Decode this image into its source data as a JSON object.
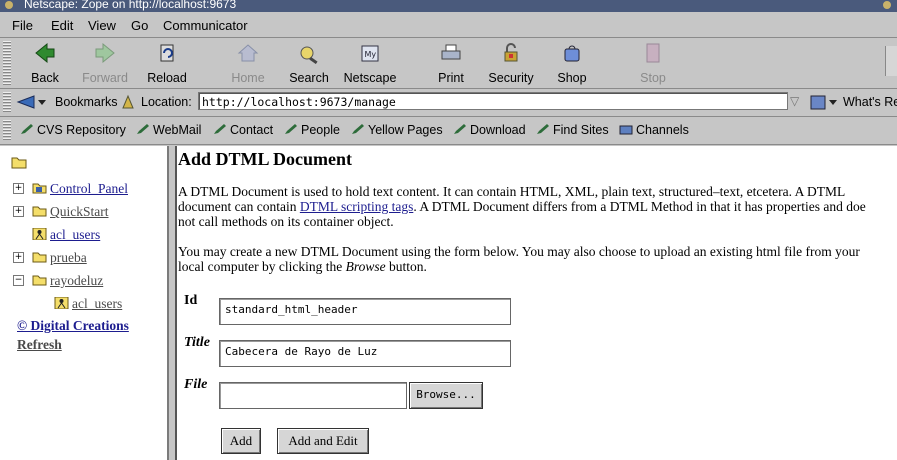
{
  "window": {
    "title": "Netscape: Zope on http://localhost:9673"
  },
  "menu": [
    "File",
    "Edit",
    "View",
    "Go",
    "Communicator"
  ],
  "toolbar": [
    {
      "label": "Back",
      "icon": "back-arrow-icon",
      "enabled": true
    },
    {
      "label": "Forward",
      "icon": "forward-arrow-icon",
      "enabled": false
    },
    {
      "label": "Reload",
      "icon": "reload-icon",
      "enabled": true
    },
    {
      "label": "Home",
      "icon": "home-icon",
      "enabled": false
    },
    {
      "label": "Search",
      "icon": "search-icon",
      "enabled": true
    },
    {
      "label": "Netscape",
      "icon": "netscape-icon",
      "enabled": true
    },
    {
      "label": "Print",
      "icon": "print-icon",
      "enabled": true
    },
    {
      "label": "Security",
      "icon": "lock-icon",
      "enabled": true
    },
    {
      "label": "Shop",
      "icon": "shop-icon",
      "enabled": true
    },
    {
      "label": "Stop",
      "icon": "stop-icon",
      "enabled": false
    }
  ],
  "location": {
    "bookmarks_label": "Bookmarks",
    "location_label": "Location:",
    "url": "http://localhost:9673/manage",
    "whats_related": "What's Re"
  },
  "personal_toolbar": [
    "CVS Repository",
    "WebMail",
    "Contact",
    "People",
    "Yellow Pages",
    "Download",
    "Find Sites",
    "Channels"
  ],
  "tree": {
    "items": [
      "Control_Panel",
      "QuickStart",
      "acl_users",
      "prueba",
      "rayodeluz",
      "acl_users"
    ],
    "copyright": "© Digital Creations",
    "refresh": "Refresh"
  },
  "main": {
    "title": "Add DTML Document",
    "intro_1": "A DTML Document is used to hold text content. It can contain HTML, XML, plain text, structured–text, etcetera. A DTML",
    "intro_2a": "document can contain ",
    "intro_2_link": "DTML scripting tags",
    "intro_2b": ". A DTML Document differs from a DTML Method in that it has properties and doe",
    "intro_3": "not call methods on its container object.",
    "upload_1": "You may create a new DTML Document using the form below. You may also choose to upload an existing html file from your",
    "upload_2a": "local computer by clicking the ",
    "upload_2_em": "Browse",
    "upload_2b": " button.",
    "form": {
      "id_label": "Id",
      "id_value": "standard_html_header",
      "title_label": "Title",
      "title_value": "Cabecera de Rayo de Luz",
      "file_label": "File",
      "file_value": "",
      "browse_label": "Browse...",
      "add_label": "Add",
      "add_edit_label": "Add and Edit"
    }
  },
  "colors": {
    "titlebar": "#4a5a7c",
    "chrome": "#c6c6c6",
    "link": "#1d1d8f"
  }
}
